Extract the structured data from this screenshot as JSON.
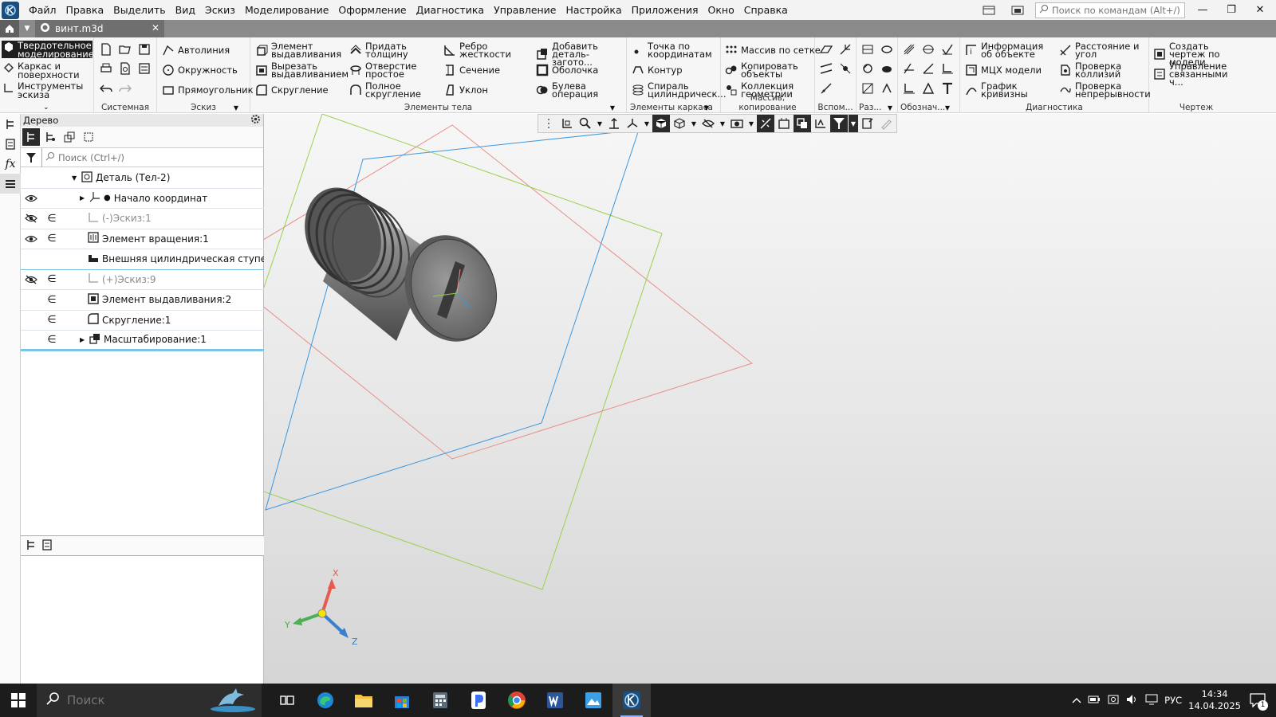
{
  "menu": {
    "items": [
      "Файл",
      "Правка",
      "Выделить",
      "Вид",
      "Эскиз",
      "Моделирование",
      "Оформление",
      "Диагностика",
      "Управление",
      "Настройка",
      "Приложения",
      "Окно",
      "Справка"
    ],
    "command_search_placeholder": "Поиск по командам (Alt+/)"
  },
  "tabs": {
    "document_tab": "винт.m3d"
  },
  "ribbon": {
    "modes": {
      "solid": "Твердотельное моделирование",
      "wireframe": "Каркас и поверхности",
      "sketch_tools": "Инструменты эскиза"
    },
    "groups": {
      "system": "Системная",
      "sketch": "Эскиз",
      "body": "Элементы тела",
      "frame": "Элементы каркаса",
      "array": "Массив, копирование",
      "aux": "Вспом...",
      "dim": "Раз...",
      "designations": "Обознач...",
      "diagnostics": "Диагностика",
      "drawing": "Чертеж"
    },
    "sketch_buttons": [
      "Автолиния",
      "Окружность",
      "Прямоугольник"
    ],
    "body_buttons": {
      "extrude": "Элемент выдавливания",
      "cut_extrude": "Вырезать выдавливанием",
      "fillet": "Скругление",
      "thicken": "Придать толщину",
      "hole": "Отверстие простое",
      "full_fillet": "Полное скругление",
      "rib": "Ребро жесткости",
      "section": "Сечение",
      "draft": "Уклон",
      "add_blank": "Добавить деталь-загото...",
      "shell": "Оболочка",
      "boolean": "Булева операция"
    },
    "frame_buttons": {
      "point": "Точка по координатам",
      "contour": "Контур",
      "spiral": "Спираль цилиндрическ..."
    },
    "array_buttons": {
      "grid": "Массив по сетке",
      "copy": "Копировать объекты",
      "collection": "Коллекция геометрии"
    },
    "diagnostics_buttons": {
      "info": "Информация об объекте",
      "mass": "МЦХ модели",
      "curvature": "График кривизны",
      "distance": "Расстояние и угол",
      "collision": "Проверка коллизий",
      "continuity": "Проверка непрерывности"
    },
    "drawing_buttons": {
      "create": "Создать чертеж по модели",
      "manage": "Управление связанными ч..."
    }
  },
  "tree": {
    "title": "Дерево",
    "search_placeholder": "Поиск (Ctrl+/)",
    "rows": [
      {
        "label": "Деталь (Тел-2)"
      },
      {
        "label": "Начало координат"
      },
      {
        "label": "(-)Эскиз:1"
      },
      {
        "label": "Элемент вращения:1"
      },
      {
        "label": "Внешняя цилиндрическая ступень с п"
      },
      {
        "label": "(+)Эскиз:9"
      },
      {
        "label": "Элемент выдавливания:2"
      },
      {
        "label": "Скругление:1"
      },
      {
        "label": "Масштабирование:1"
      }
    ]
  },
  "axes": {
    "x": "X",
    "y": "Y",
    "z": "Z"
  },
  "taskbar": {
    "search_placeholder": "Поиск",
    "language": "РУС",
    "time": "14:34",
    "date": "14.04.2025",
    "notifications": "1"
  },
  "colors": {
    "plane_red": "#e8908c",
    "plane_green": "#9ad14b",
    "plane_blue": "#3a98e0",
    "accent": "#1b4e7a"
  }
}
